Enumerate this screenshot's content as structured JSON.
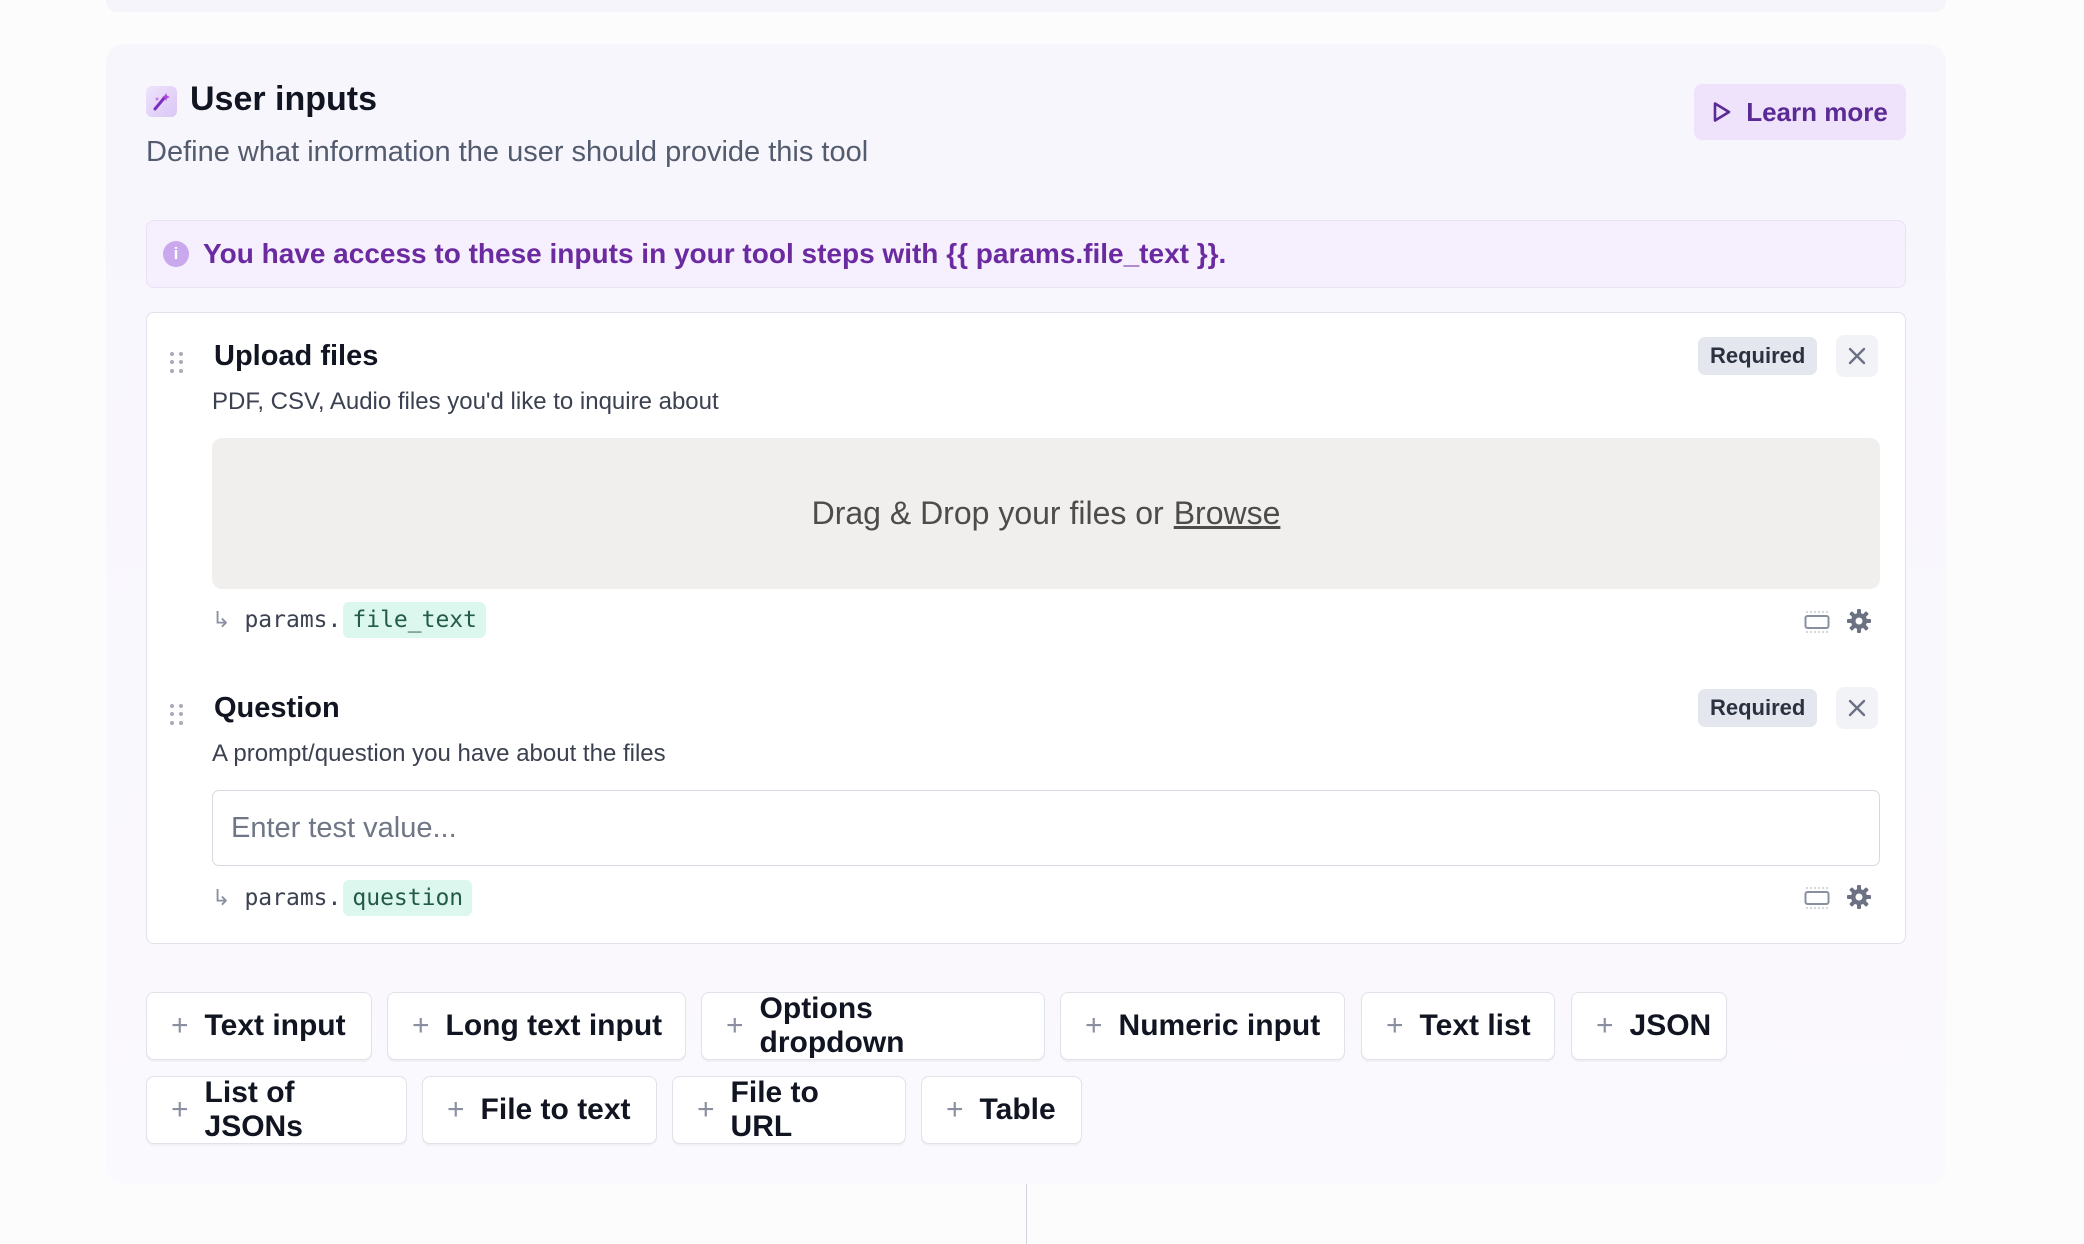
{
  "section": {
    "title": "User inputs",
    "subtitle": "Define what information the user should provide this tool",
    "learn_more_label": "Learn more"
  },
  "banner": {
    "text": "You have access to these inputs in your tool steps with {{ params.file_text }}."
  },
  "fields": [
    {
      "title": "Upload files",
      "description": "PDF, CSV, Audio files you'd like to inquire about",
      "badge": "Required",
      "dropzone_text": "Drag & Drop your files or",
      "dropzone_link": "Browse",
      "param_prefix": "params.",
      "param_key": "file_text"
    },
    {
      "title": "Question",
      "description": "A prompt/question you have about the files",
      "badge": "Required",
      "placeholder": "Enter test value...",
      "param_prefix": "params.",
      "param_key": "question"
    }
  ],
  "add_buttons": [
    "Text input",
    "Long text input",
    "Options dropdown",
    "Numeric input",
    "Text list",
    "JSON",
    "List of JSONs",
    "File to text",
    "File to URL",
    "Table"
  ],
  "icons": {
    "header": "wand-icon",
    "learn_more": "play-icon",
    "banner": "info-icon",
    "drag": "drag-handle-icon",
    "close": "close-icon",
    "resize": "input-size-icon",
    "settings": "gear-icon",
    "add": "plus-icon"
  },
  "colors": {
    "accent": "#6b2aa0",
    "param_bg": "#dcf7ee"
  }
}
